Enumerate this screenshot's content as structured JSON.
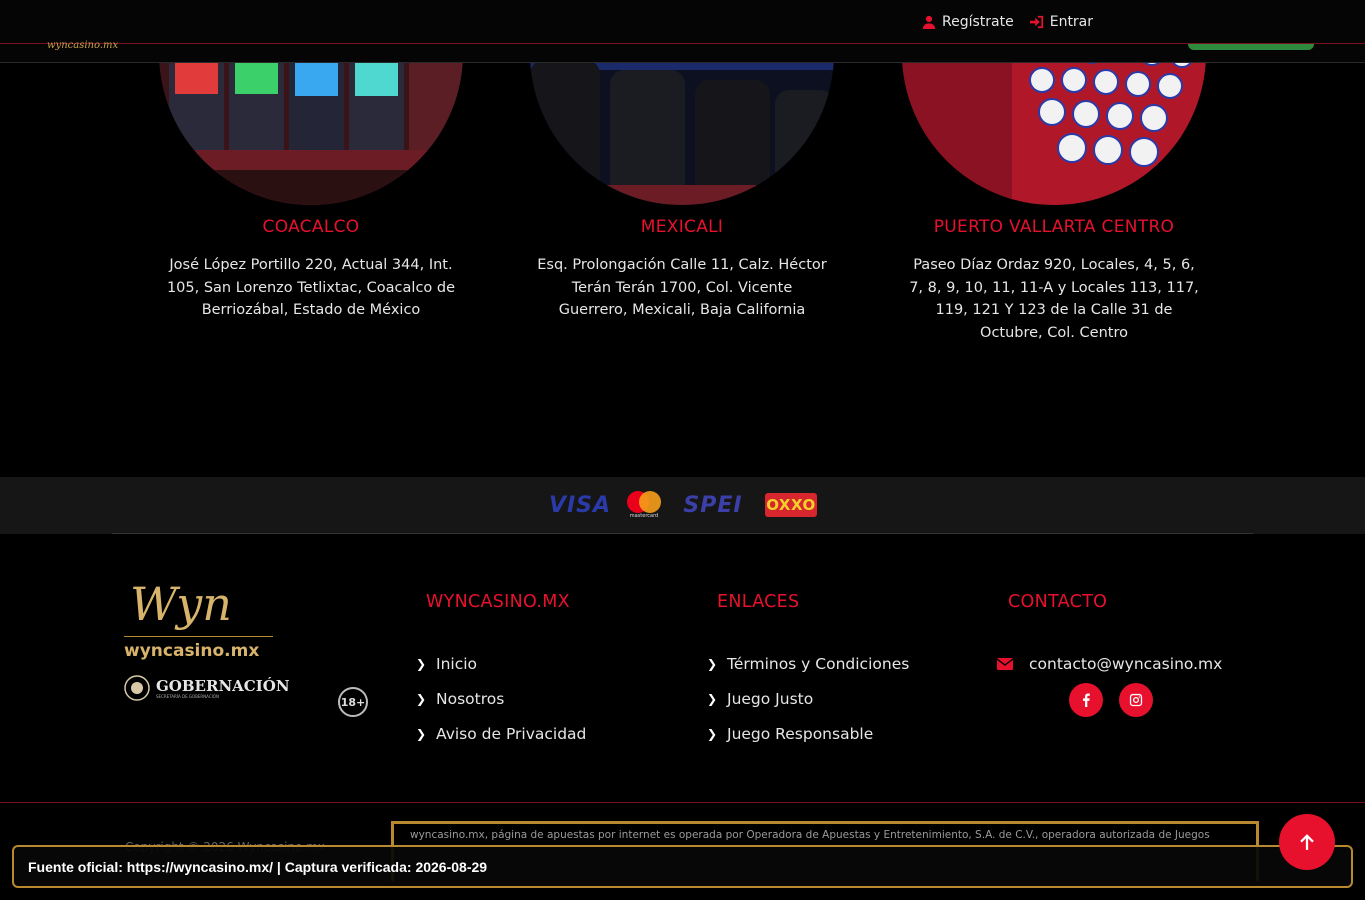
{
  "header": {
    "brand_small": "wyncasino.mx",
    "register_label": "Regístrate",
    "login_label": "Entrar"
  },
  "casinos": [
    {
      "city": "COACALCO",
      "address": "José López Portillo 220, Actual 344, Int. 105, San Lorenzo Tetlixtac, Coacalco de Berriozábal, Estado de México"
    },
    {
      "city": "MEXICALI",
      "address": "Esq. Prolongación Calle 11, Calz. Héctor Terán Terán 1700, Col. Vicente Guerrero, Mexicali, Baja California"
    },
    {
      "city": "PUERTO VALLARTA CENTRO",
      "address": "Paseo Díaz Ordaz  920, Locales, 4, 5, 6, 7, 8, 9, 10, 11, 11-A y Locales 113, 117, 119, 121 Y 123 de la Calle 31 de Octubre, Col. Centro"
    }
  ],
  "payments": {
    "visa": "VISA",
    "mastercard": "mastercard",
    "spei": "SPEI",
    "oxxo": "OXXO"
  },
  "footer": {
    "logo_script": "Wyn",
    "logo_text": "wyncasino.mx",
    "gob_label": "GOBERNACIÓN",
    "gob_sub": "SECRETARÍA DE GOBERNACIÓN",
    "age_label": "18+",
    "col1_title": "WYNCASINO.MX",
    "col1_links": [
      "Inicio",
      "Nosotros",
      "Aviso de Privacidad"
    ],
    "col2_title": "ENLACES",
    "col2_links": [
      "Términos y Condiciones",
      "Juego Justo",
      "Juego Responsable"
    ],
    "col3_title": "CONTACTO",
    "email": "contacto@wyncasino.mx",
    "legal_text": "wyncasino.mx, página de apuestas por internet es operada por Operadora de Apuestas y Entretenimiento, S.A. de C.V., operadora autorizada de Juegos",
    "copyright": "Copyright © 2026 Wyncasino.mx"
  },
  "source_bar": "Fuente oficial: https://wyncasino.mx/ | Captura verificada: 2026-08-29",
  "colors": {
    "accent": "#e8112d",
    "gold": "#b8892f",
    "background": "#000000"
  }
}
